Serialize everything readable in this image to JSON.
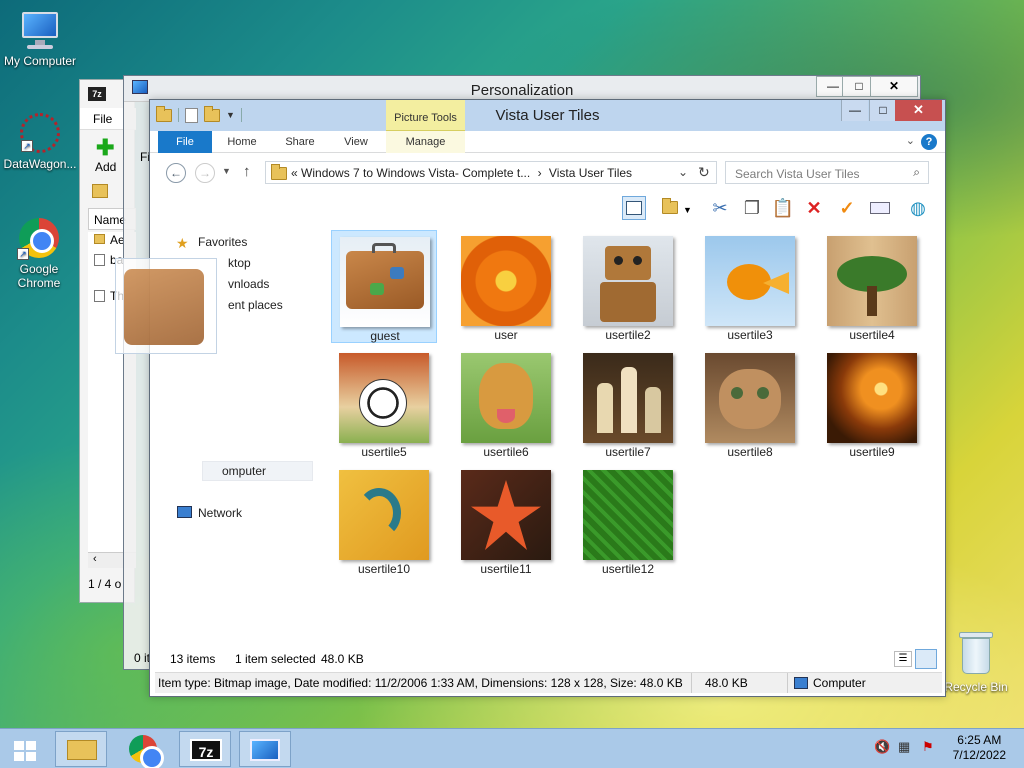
{
  "desktop": {
    "icons": [
      {
        "label": "My Computer"
      },
      {
        "label": "DataWagon..."
      },
      {
        "label": "Google Chrome"
      },
      {
        "label": "Recycle Bin"
      }
    ]
  },
  "window_7zip": {
    "icon_text": "7z",
    "menu_file": "File",
    "add_label": "Add",
    "column_name": "Name",
    "rows": [
      "Ae",
      "ba",
      "Th"
    ],
    "status": "1 / 4 o",
    "status2": "0 it"
  },
  "window_personalization": {
    "title": "Personalization",
    "fi_text": "Fi"
  },
  "explorer": {
    "title": "Vista User Tiles",
    "picture_tools": "Picture Tools",
    "tabs": [
      "File",
      "Home",
      "Share",
      "View",
      "Manage"
    ],
    "address": {
      "prefix": "«",
      "path1": "Windows 7 to Windows Vista- Complete t...",
      "sep": "›",
      "path2": "Vista User Tiles"
    },
    "search_placeholder": "Search Vista User Tiles",
    "nav_items": [
      {
        "label": "Favorites"
      },
      {
        "label": "ktop"
      },
      {
        "label": "vnloads"
      },
      {
        "label": "ent places"
      },
      {
        "label": "omputer"
      },
      {
        "label": "Network"
      }
    ],
    "tiles": [
      {
        "label": "guest"
      },
      {
        "label": "user"
      },
      {
        "label": "usertile2"
      },
      {
        "label": "usertile3"
      },
      {
        "label": "usertile4"
      },
      {
        "label": "usertile5"
      },
      {
        "label": "usertile6"
      },
      {
        "label": "usertile7"
      },
      {
        "label": "usertile8"
      },
      {
        "label": "usertile9"
      },
      {
        "label": "usertile10"
      },
      {
        "label": "usertile11"
      },
      {
        "label": "usertile12"
      }
    ],
    "status": {
      "items": "13 items",
      "selected": "1 item selected",
      "size": "48.0 KB"
    },
    "details_bar": {
      "info": "Item type: Bitmap image, Date modified: 11/2/2006 1:33 AM, Dimensions: 128 x 128, Size: 48.0 KB",
      "size": "48.0 KB",
      "location": "Computer"
    }
  },
  "taskbar": {
    "time": "6:25 AM",
    "date": "7/12/2022",
    "icon_7z": "7z"
  }
}
